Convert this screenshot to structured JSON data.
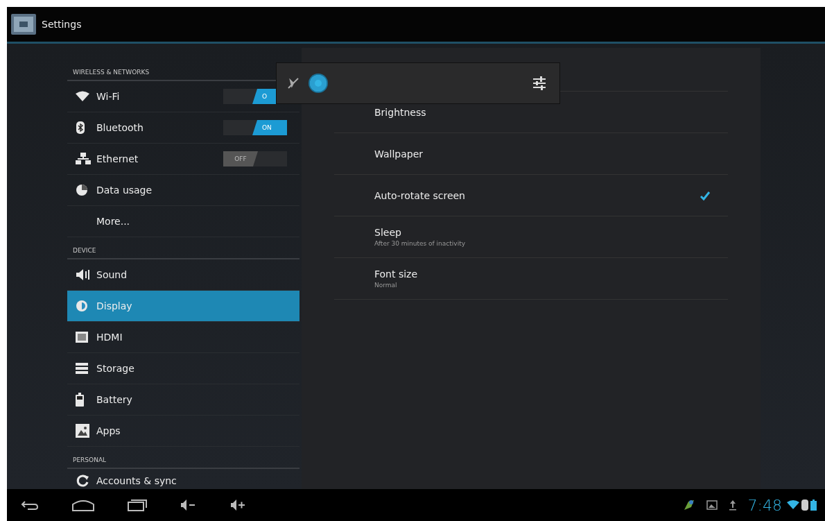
{
  "window": {
    "title": "Settings"
  },
  "sidebar": {
    "sections": [
      {
        "header": "WIRELESS & NETWORKS",
        "items": [
          {
            "label": "Wi-Fi",
            "selected": false,
            "toggle": {
              "on": true,
              "label": "O"
            }
          },
          {
            "label": "Bluetooth",
            "selected": false,
            "toggle": {
              "on": true,
              "label": "ON"
            }
          },
          {
            "label": "Ethernet",
            "selected": false,
            "toggle": {
              "on": false,
              "label": "OFF"
            }
          },
          {
            "label": "Data usage",
            "selected": false
          },
          {
            "label": "More...",
            "selected": false
          }
        ]
      },
      {
        "header": "DEVICE",
        "items": [
          {
            "label": "Sound",
            "selected": false
          },
          {
            "label": "Display",
            "selected": true
          },
          {
            "label": "HDMI",
            "selected": false
          },
          {
            "label": "Storage",
            "selected": false
          },
          {
            "label": "Battery",
            "selected": false
          },
          {
            "label": "Apps",
            "selected": false
          }
        ]
      },
      {
        "header": "PERSONAL",
        "items": [
          {
            "label": "Accounts & sync",
            "selected": false
          }
        ]
      }
    ]
  },
  "display_settings": [
    {
      "kind": "plain",
      "title": "Brightness"
    },
    {
      "kind": "plain",
      "title": "Wallpaper"
    },
    {
      "kind": "checkbox",
      "title": "Auto-rotate screen",
      "checked": true
    },
    {
      "kind": "plain",
      "title": "Sleep",
      "summary": "After 30 minutes of inactivity"
    },
    {
      "kind": "plain",
      "title": "Font size",
      "summary": "Normal"
    }
  ],
  "brightness_popup": {
    "level": 0
  },
  "status_bar": {
    "time": "7:48"
  }
}
